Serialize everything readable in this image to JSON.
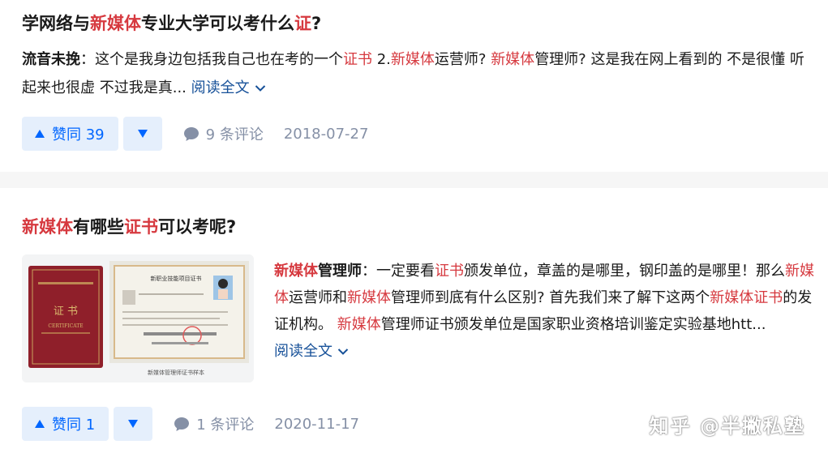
{
  "colors": {
    "highlight": "#d6393f",
    "link": "#175199",
    "vote": "#0066ff",
    "meta": "#8590a6"
  },
  "answers": [
    {
      "title": [
        "学网络与",
        "新媒体",
        "专业大学可以考什么",
        "证",
        "?"
      ],
      "author": "流音未挽",
      "excerpt": [
        "这个是我身边包括我自己也在考的一个",
        "证书",
        " 2.",
        "新媒体",
        "运营师? ",
        "新媒体",
        "管理师? 这是我在网上看到的 不是很懂 听起来也很虚 不过我是真..."
      ],
      "read_more": "阅读全文",
      "vote_label": "赞同 39",
      "comments": "9 条评论",
      "date": "2018-07-27"
    },
    {
      "title": [
        "新媒体",
        "有哪些",
        "证书",
        "可以考呢?"
      ],
      "author": "新媒体",
      "author_rest": "管理师",
      "excerpt": [
        "一定要看",
        "证书",
        "颁发单位，章盖的是哪里，钢印盖的是哪里！那么",
        "新媒体",
        "运营师和",
        "新媒体",
        "管理师到底有什么区别? 首先我们来了解下这两个",
        "新媒体证书",
        "的发证机构。 ",
        "新媒体",
        "管理师证书颁发单位是国家职业资格培训鉴定实验基地htt..."
      ],
      "read_more": "阅读全文",
      "thumbnail": {
        "book_title": "证  书",
        "book_subtitle": "CERTIFICATE",
        "doc_title": "新职业技能项目证书",
        "caption": "新媒体管理师证书样本"
      },
      "vote_label": "赞同 1",
      "comments": "1 条评论",
      "date": "2020-11-17"
    }
  ],
  "watermark": "知乎 @半撇私塾",
  "icons": {
    "comment": "comment-icon",
    "chevron": "chevron-down-icon",
    "up": "upvote-triangle-icon",
    "down": "downvote-triangle-icon"
  }
}
